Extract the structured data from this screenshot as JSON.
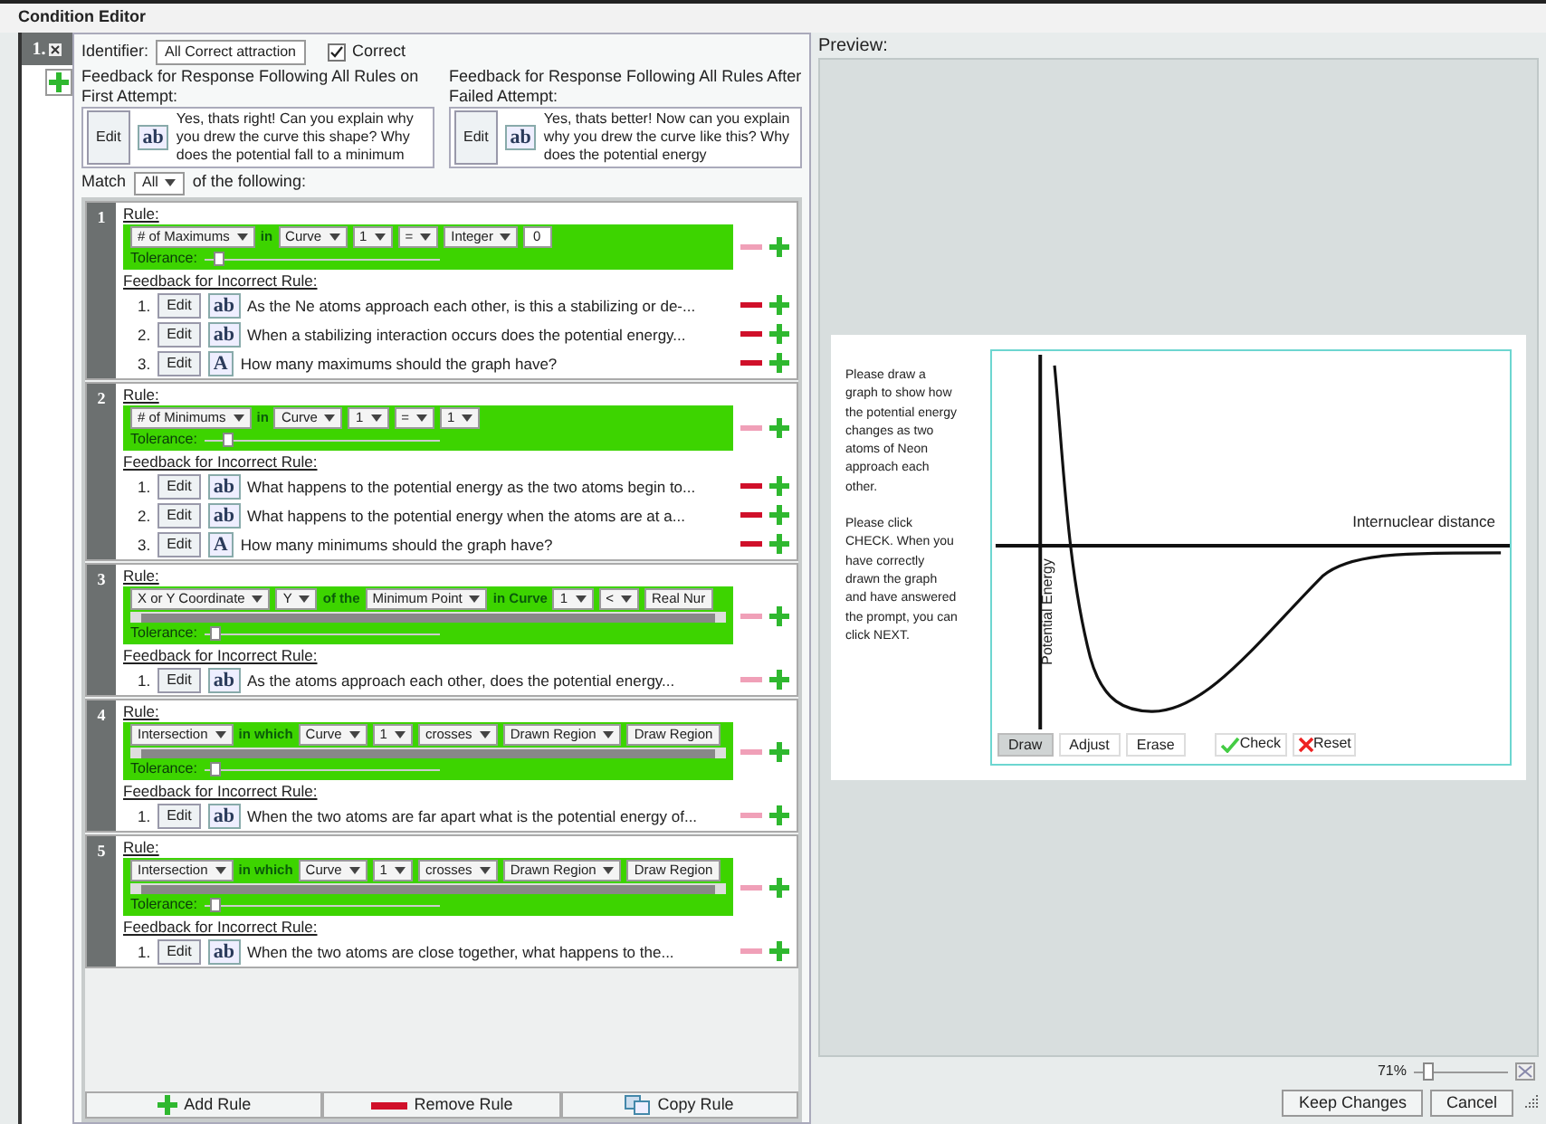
{
  "title": "Condition Editor",
  "condition": {
    "number": "1.",
    "identifier_label": "Identifier:",
    "identifier": "All Correct attraction",
    "correct": {
      "label": "Correct",
      "checked": true
    },
    "feedback": [
      {
        "label": "Feedback for Response Following All Rules on First Attempt:",
        "edit": "Edit",
        "icon": "ab",
        "text": "Yes, thats right!  Can you explain why you drew the curve this shape? Why does the potential fall to a minimum"
      },
      {
        "label": "Feedback for Response Following All Rules After Failed Attempt:",
        "edit": "Edit",
        "icon": "ab",
        "text": "Yes, thats better! Now can you explain why you drew the curve like this? Why does the potential energy"
      }
    ],
    "match": {
      "prefix": "Match",
      "value": "All",
      "suffix": "of the following:"
    },
    "rules": [
      {
        "number": "1",
        "label": "Rule:",
        "scrollbar": false,
        "tolerance_label": "Tolerance:",
        "tolerance": {
          "level": 0.04
        },
        "remove_disabled": true,
        "feedback_label": "Feedback for Incorrect Rule:",
        "conditions": [
          {
            "kind": "dropdown",
            "text": "# of Maximums"
          },
          {
            "kind": "word",
            "text": "in"
          },
          {
            "kind": "dropdown",
            "text": "Curve"
          },
          {
            "kind": "dropdown",
            "text": "1"
          },
          {
            "kind": "dropdown",
            "text": "="
          },
          {
            "kind": "dropdown",
            "text": "Integer"
          },
          {
            "kind": "number",
            "text": "0"
          }
        ],
        "feedback": [
          {
            "number": "1.",
            "edit": "Edit",
            "icon": "ab",
            "text": "As the Ne atoms approach each other, is this a stabilizing or de-...",
            "remove_disabled": false
          },
          {
            "number": "2.",
            "edit": "Edit",
            "icon": "ab",
            "text": "When a stabilizing interaction occurs does the potential energy...",
            "remove_disabled": false
          },
          {
            "number": "3.",
            "edit": "Edit",
            "icon": "A",
            "text": "How many maximums should the graph have?",
            "remove_disabled": false
          }
        ]
      },
      {
        "number": "2",
        "label": "Rule:",
        "scrollbar": false,
        "tolerance_label": "Tolerance:",
        "tolerance": {
          "level": 0.08
        },
        "remove_disabled": true,
        "feedback_label": "Feedback for Incorrect Rule:",
        "conditions": [
          {
            "kind": "dropdown",
            "text": "# of Minimums"
          },
          {
            "kind": "word",
            "text": "in"
          },
          {
            "kind": "dropdown",
            "text": "Curve"
          },
          {
            "kind": "dropdown",
            "text": "1"
          },
          {
            "kind": "dropdown",
            "text": "="
          },
          {
            "kind": "dropdown",
            "text": "1"
          }
        ],
        "feedback": [
          {
            "number": "1.",
            "edit": "Edit",
            "icon": "ab",
            "text": "What happens to the potential energy as the two atoms begin to...",
            "remove_disabled": false
          },
          {
            "number": "2.",
            "edit": "Edit",
            "icon": "ab",
            "text": "What happens to the potential energy when the atoms are at a...",
            "remove_disabled": false
          },
          {
            "number": "3.",
            "edit": "Edit",
            "icon": "A",
            "text": "How many minimums should the graph have?",
            "remove_disabled": false
          }
        ]
      },
      {
        "number": "3",
        "label": "Rule:",
        "scrollbar": true,
        "tolerance_label": "Tolerance:",
        "tolerance": {
          "level": 0.02
        },
        "remove_disabled": true,
        "feedback_label": "Feedback for Incorrect Rule:",
        "conditions": [
          {
            "kind": "dropdown",
            "text": "X or Y Coordinate"
          },
          {
            "kind": "dropdown",
            "text": "Y"
          },
          {
            "kind": "word",
            "text": "of the"
          },
          {
            "kind": "dropdown",
            "text": "Minimum Point"
          },
          {
            "kind": "word",
            "text": "in Curve"
          },
          {
            "kind": "dropdown",
            "text": "1"
          },
          {
            "kind": "dropdown",
            "text": "<"
          },
          {
            "kind": "cut",
            "text": "Real Nur"
          }
        ],
        "feedback": [
          {
            "number": "1.",
            "edit": "Edit",
            "icon": "ab",
            "text": "As the atoms approach each other, does the potential energy...",
            "remove_disabled": true
          }
        ]
      },
      {
        "number": "4",
        "label": "Rule:",
        "scrollbar": true,
        "tolerance_label": "Tolerance:",
        "tolerance": {
          "level": 0.02
        },
        "remove_disabled": true,
        "feedback_label": "Feedback for Incorrect Rule:",
        "conditions": [
          {
            "kind": "dropdown",
            "text": "Intersection"
          },
          {
            "kind": "word",
            "text": "in which"
          },
          {
            "kind": "dropdown",
            "text": "Curve"
          },
          {
            "kind": "dropdown",
            "text": "1"
          },
          {
            "kind": "dropdown",
            "text": "crosses"
          },
          {
            "kind": "dropdown",
            "text": "Drawn Region"
          },
          {
            "kind": "cut",
            "text": "Draw Region"
          }
        ],
        "feedback": [
          {
            "number": "1.",
            "edit": "Edit",
            "icon": "ab",
            "text": "When the two atoms are far apart what is the potential energy of...",
            "remove_disabled": true
          }
        ]
      },
      {
        "number": "5",
        "label": "Rule:",
        "scrollbar": true,
        "tolerance_label": "Tolerance:",
        "tolerance": {
          "level": 0.02
        },
        "remove_disabled": true,
        "feedback_label": "Feedback for Incorrect Rule:",
        "conditions": [
          {
            "kind": "dropdown",
            "text": "Intersection"
          },
          {
            "kind": "word",
            "text": "in which"
          },
          {
            "kind": "dropdown",
            "text": "Curve"
          },
          {
            "kind": "dropdown",
            "text": "1"
          },
          {
            "kind": "dropdown",
            "text": "crosses"
          },
          {
            "kind": "dropdown",
            "text": "Drawn Region"
          },
          {
            "kind": "cut",
            "text": "Draw Region"
          }
        ],
        "feedback": [
          {
            "number": "1.",
            "edit": "Edit",
            "icon": "ab",
            "text": "When the two atoms are close together, what happens to the...",
            "remove_disabled": true
          }
        ]
      }
    ]
  },
  "footer_buttons": [
    {
      "kind": "add",
      "label": "Add Rule"
    },
    {
      "kind": "remove",
      "label": "Remove Rule"
    },
    {
      "kind": "copy",
      "label": "Copy Rule"
    }
  ],
  "preview": {
    "label": "Preview:",
    "instructions": [
      "Please draw a graph to show how the potential energy changes as two atoms of Neon approach each other.",
      "Please click CHECK. When you have correctly drawn the graph and have answered the prompt, you can click NEXT."
    ],
    "x_axis": "Internuclear distance",
    "y_axis": "Potential Energy",
    "tools": [
      {
        "label": "Draw",
        "selected": true
      },
      {
        "label": "Adjust",
        "selected": false
      },
      {
        "label": "Erase",
        "selected": false
      }
    ],
    "actions": [
      {
        "kind": "check",
        "label": "Check"
      },
      {
        "kind": "reset",
        "label": "Reset"
      }
    ]
  },
  "zoom": {
    "reading": "71%",
    "level": 0.1
  },
  "buttons": [
    "Keep Changes",
    "Cancel"
  ]
}
